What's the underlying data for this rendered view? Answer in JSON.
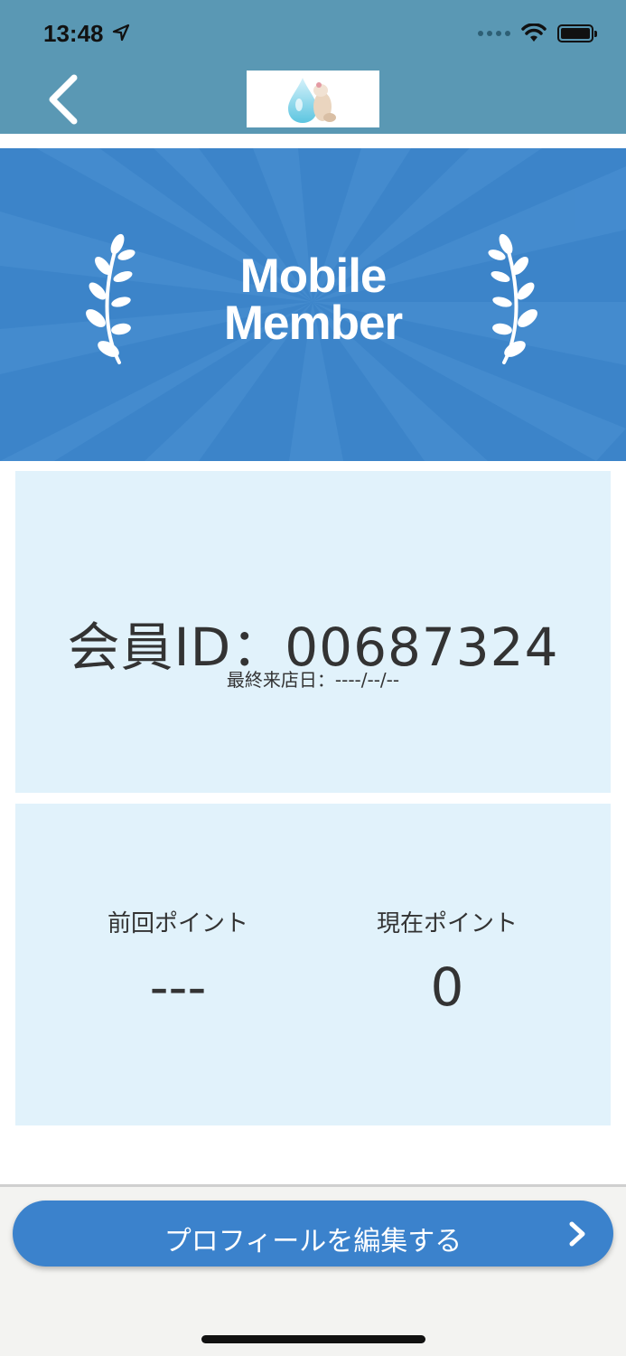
{
  "status_bar": {
    "time": "13:48"
  },
  "nav": {
    "back_icon": "chevron-left-icon",
    "logo_icon": "brand-logo"
  },
  "banner": {
    "title_line1": "Mobile",
    "title_line2": "Member",
    "color": "#3c84c9"
  },
  "member_card": {
    "member_id_label": "会員ID：00687324",
    "last_visit": "最終来店日：----/--/--"
  },
  "points_card": {
    "previous_label": "前回ポイント",
    "previous_value": "---",
    "current_label": "現在ポイント",
    "current_value": "0"
  },
  "edit_profile_button": {
    "label": "プロフィールを編集する",
    "icon": "chevron-right-icon"
  },
  "colors": {
    "nav": "#5a98b4",
    "card": "#e1f2fb",
    "button": "#3b82cc"
  }
}
